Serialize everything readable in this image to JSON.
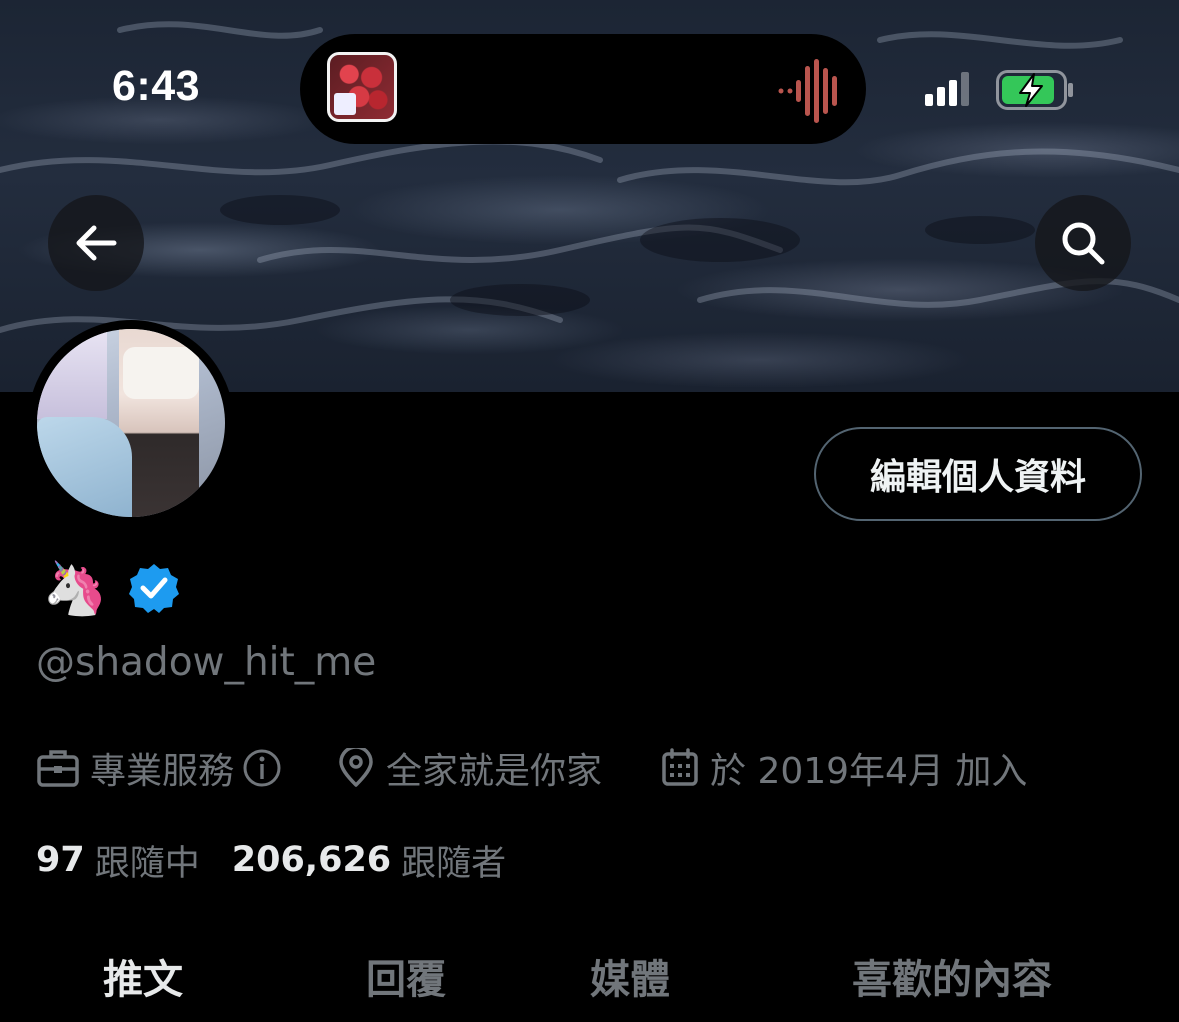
{
  "status_bar": {
    "time": "6:43",
    "icons": [
      "signal-icon",
      "battery-charging-icon"
    ],
    "live_activity": {
      "icons": [
        "album-art-icon",
        "audio-waveform-icon"
      ]
    }
  },
  "header": {
    "back_icon": "arrow-left-icon",
    "search_icon": "search-icon"
  },
  "profile": {
    "display_name": "🦄",
    "verified_icon": "verified-badge-icon",
    "handle": "@shadow_hit_me",
    "edit_button_label": "編輯個人資料",
    "category": "專業服務",
    "category_info_icon": "info-icon",
    "location": "全家就是你家",
    "joined": "於 2019年4月 加入",
    "following_count": "97",
    "following_label": "跟隨中",
    "followers_count": "206,626",
    "followers_label": "跟隨者"
  },
  "tabs": [
    {
      "label": "推文",
      "active": true
    },
    {
      "label": "回覆",
      "active": false
    },
    {
      "label": "媒體",
      "active": false
    },
    {
      "label": "喜歡的內容",
      "active": false
    }
  ],
  "colors": {
    "background": "#000000",
    "text_primary": "#e7e9ea",
    "text_secondary": "#71767b",
    "verified": "#1d9bf0",
    "battery": "#34c759"
  }
}
